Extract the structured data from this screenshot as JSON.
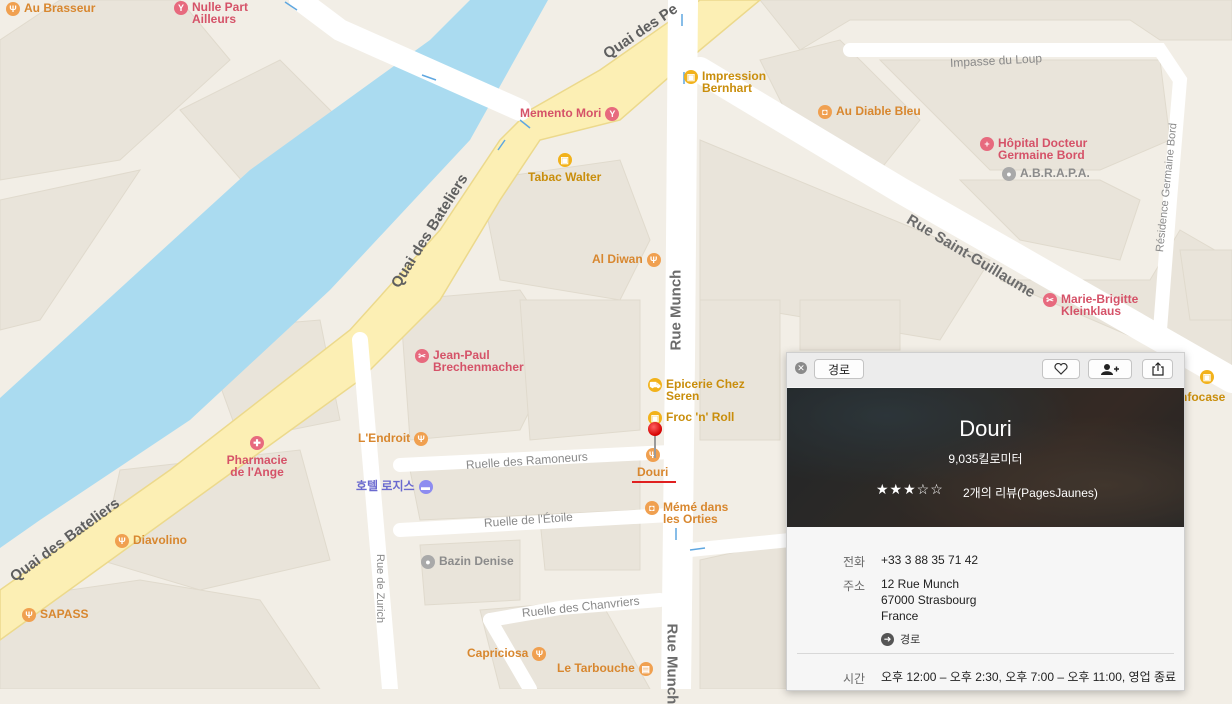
{
  "streets": {
    "quai_bateliers_1": "Quai des Bateliers",
    "quai_bateliers_2": "Quai des Bateliers",
    "quai_pe": "Quai des Pe",
    "rue_munch_1": "Rue Munch",
    "rue_munch_2": "Rue Munch",
    "rue_saint_guillaume": "Rue Saint-Guillaume",
    "impasse_loup": "Impasse du Loup",
    "residence_germaine": "Résidence Germaine Bord",
    "ruelle_ramoneurs": "Ruelle des Ramoneurs",
    "ruelle_etoile": "Ruelle de l'Étoile",
    "ruelle_chanvriers": "Ruelle des Chanvriers",
    "rue_zurich": "Rue de Zurich"
  },
  "pois": {
    "au_brasseur": "Au Brasseur",
    "nulle_part": "Nulle Part Ailleurs",
    "memento_mori": "Memento Mori",
    "impression_bernhart": "Impression Bernhart",
    "au_diable_bleu": "Au Diable Bleu",
    "hopital": "Hôpital Docteur Germaine Bord",
    "abrapa": "A.B.R.A.P.A.",
    "tabac_walter": "Tabac Walter",
    "al_diwan": "Al Diwan",
    "marie_brigitte": "Marie-Brigitte Kleinklaus",
    "jean_paul": "Jean-Paul Brechenmacher",
    "epicerie": "Epicerie Chez Seren",
    "froc_roll": "Froc 'n' Roll",
    "l_endroit": "L'Endroit",
    "pharmacie": "Pharmacie de l'Ange",
    "douri": "Douri",
    "hotel_rogis": "호텔 로지스",
    "meme_orties": "Mémé dans les Orties",
    "diavolino": "Diavolino",
    "bazin_denise": "Bazin Denise",
    "sapass": "SAPASS",
    "capriciosa": "Capriciosa",
    "le_tarbouche": "Le Tarbouche",
    "infocase": "nfocase"
  },
  "panel": {
    "directions_button": "경로",
    "name": "Douri",
    "distance": "9,035킬로미터",
    "rating_stars": "★★★☆☆",
    "rating": 3,
    "rating_max": 5,
    "reviews": "2개의 리뷰(PagesJaunes)",
    "phone_label": "전화",
    "phone": "+33 3 88 35 71 42",
    "address_label": "주소",
    "address_line1": "12 Rue Munch",
    "address_line2": "67000 Strasbourg",
    "address_line3": "France",
    "directions_link": "경로",
    "hours_label": "시간",
    "hours": "오후 12:00 – 오후 2:30, 오후 7:00 – 오후 11:00, 영업 종료"
  },
  "colors": {
    "river": "#aadbf0",
    "main_road": "#fcefb4",
    "land": "#f2eee6",
    "building": "#e9e4da",
    "pin": "#e02020"
  }
}
